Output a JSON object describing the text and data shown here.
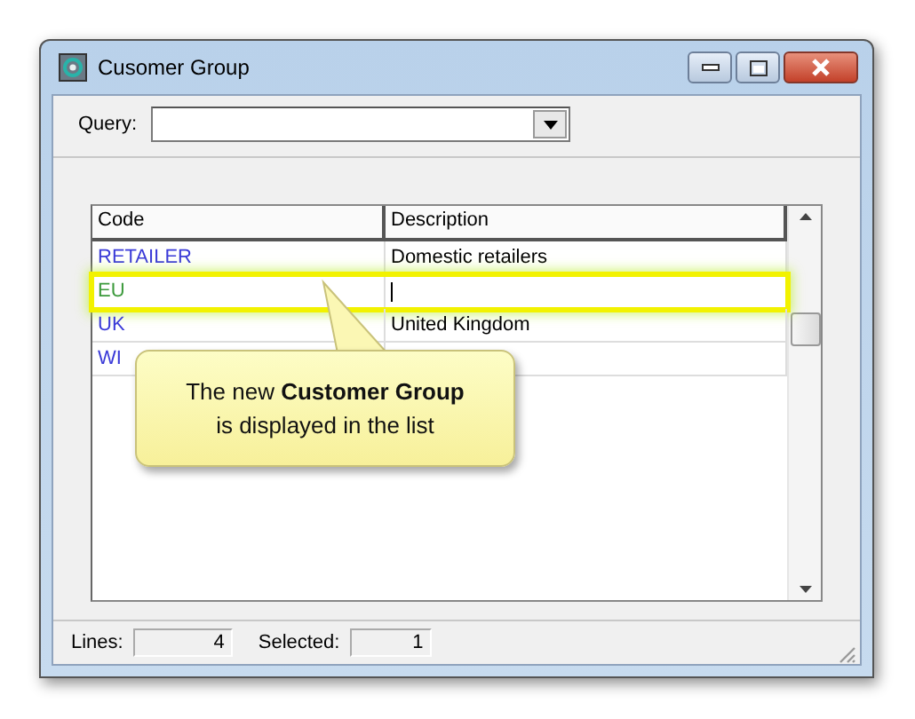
{
  "window": {
    "title": "Cusomer Group"
  },
  "query": {
    "label": "Query:"
  },
  "table": {
    "columns": [
      "Code",
      "Description"
    ],
    "rows": [
      {
        "code": "RETAILER",
        "description": "Domestic retailers",
        "color": "#3a3ad8",
        "selected": false
      },
      {
        "code": "EU",
        "description": "",
        "color": "#3c9a3c",
        "selected": true
      },
      {
        "code": "UK",
        "description": "United Kingdom",
        "color": "#3a3ad8",
        "selected": false
      },
      {
        "code": "WI",
        "description": "",
        "color": "#3a3ad8",
        "selected": false
      }
    ]
  },
  "callout": {
    "text": "The new **Customer Group** is displayed in the list"
  },
  "status_bar": {
    "lines_label": "Lines:",
    "lines": "4",
    "selected_label": "Selected:",
    "selected": "1"
  }
}
